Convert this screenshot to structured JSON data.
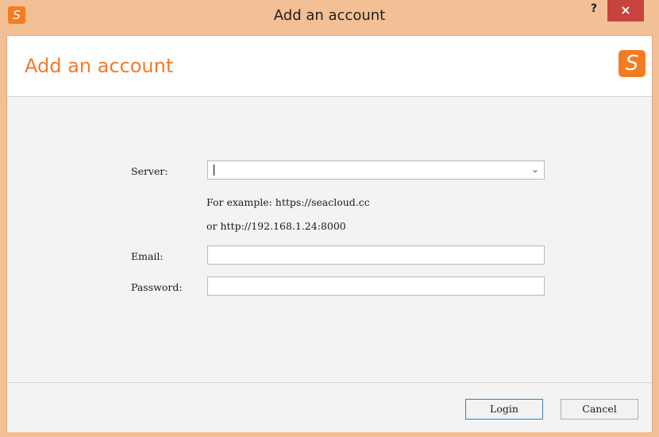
{
  "window": {
    "title": "Add an account",
    "app_icon": "S",
    "help_label": "?",
    "close_label": "×"
  },
  "header": {
    "title": "Add an account",
    "logo_letter": "S"
  },
  "form": {
    "server_label": "Server:",
    "server_value": "",
    "example_line1": "For example: https://seacloud.cc",
    "example_line2": "or http://192.168.1.24:8000",
    "email_label": "Email:",
    "email_value": "",
    "password_label": "Password:",
    "password_value": ""
  },
  "buttons": {
    "login": "Login",
    "cancel": "Cancel"
  },
  "colors": {
    "accent": "#f37a28",
    "titlebar": "#f3bf94",
    "close": "#c7433f"
  },
  "icons": [
    "seafile-logo-icon",
    "help-icon",
    "close-icon",
    "chevron-down-icon"
  ]
}
